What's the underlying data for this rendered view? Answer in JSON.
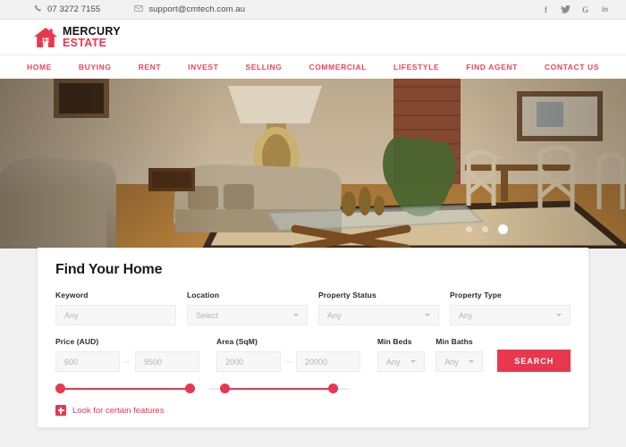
{
  "topbar": {
    "phone": "07 3272 7155",
    "email": "support@cmtech.com.au",
    "phone_icon": "phone-icon",
    "email_icon": "envelope-icon",
    "socials": [
      {
        "name": "facebook-icon",
        "glyph": "f"
      },
      {
        "name": "twitter-icon",
        "glyph": "✈"
      },
      {
        "name": "google-icon",
        "glyph": "G"
      },
      {
        "name": "linkedin-icon",
        "glyph": "in"
      }
    ]
  },
  "brand": {
    "name_top": "MERCURY",
    "name_bottom": "ESTATE",
    "icon": "house-icon",
    "accent": "#e8384f"
  },
  "nav": {
    "items": [
      {
        "label": "HOME"
      },
      {
        "label": "BUYING"
      },
      {
        "label": "RENT"
      },
      {
        "label": "INVEST"
      },
      {
        "label": "SELLING"
      },
      {
        "label": "COMMERCIAL"
      },
      {
        "label": "LIFESTYLE"
      },
      {
        "label": "FIND AGENT"
      },
      {
        "label": "CONTACT US"
      }
    ]
  },
  "hero": {
    "alt": "living room interior with sofas, coffee table and dining chairs",
    "dots": [
      {
        "active": false
      },
      {
        "active": false
      },
      {
        "active": true
      }
    ]
  },
  "search_panel": {
    "title": "Find Your Home",
    "keyword": {
      "label": "Keyword",
      "placeholder": "Any",
      "value": ""
    },
    "location": {
      "label": "Location",
      "value": "Select"
    },
    "property_status": {
      "label": "Property Status",
      "value": "Any"
    },
    "property_type": {
      "label": "Property Type",
      "value": "Any"
    },
    "price": {
      "label": "Price (AUD)",
      "min_placeholder": "600",
      "max_placeholder": "9500",
      "separator": "–"
    },
    "area": {
      "label": "Area (SqM)",
      "min_placeholder": "2000",
      "max_placeholder": "20000",
      "separator": "–"
    },
    "min_beds": {
      "label": "Min Beds",
      "value": "Any"
    },
    "min_baths": {
      "label": "Min Baths",
      "value": "Any"
    },
    "search_button": "SEARCH",
    "features_link": {
      "label": "Look for certain features",
      "icon": "plus-icon"
    }
  }
}
